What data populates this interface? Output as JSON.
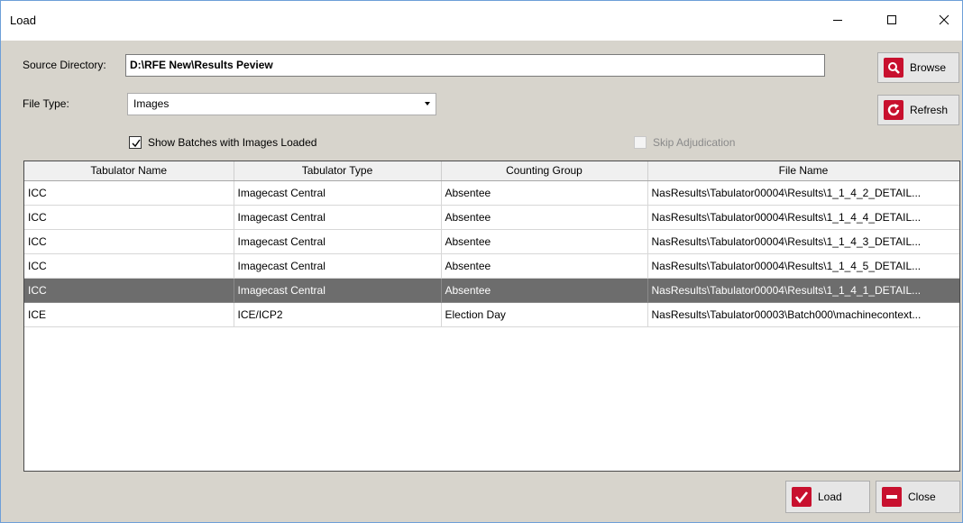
{
  "window": {
    "title": "Load"
  },
  "form": {
    "source_label": "Source Directory:",
    "source_value": "D:\\RFE New\\Results Peview",
    "filetype_label": "File Type:",
    "filetype_selected": "Images",
    "show_batches_label": "Show Batches with Images Loaded",
    "show_batches_checked": true,
    "skip_adjudication_label": "Skip Adjudication",
    "skip_adjudication_enabled": false
  },
  "buttons": {
    "browse": "Browse",
    "refresh": "Refresh",
    "load": "Load",
    "close": "Close"
  },
  "colors": {
    "browse_icon_bg": "#c8102e",
    "refresh_icon_bg": "#c8102e",
    "load_icon_bg": "#c8102e",
    "close_icon_bg": "#c8102e",
    "selected_row_bg": "#6d6d6d"
  },
  "table": {
    "columns": [
      "Tabulator Name",
      "Tabulator Type",
      "Counting Group",
      "File Name"
    ],
    "rows": [
      [
        "ICC",
        "Imagecast Central",
        "Absentee",
        "NasResults\\Tabulator00004\\Results\\1_1_4_2_DETAIL..."
      ],
      [
        "ICC",
        "Imagecast Central",
        "Absentee",
        "NasResults\\Tabulator00004\\Results\\1_1_4_4_DETAIL..."
      ],
      [
        "ICC",
        "Imagecast Central",
        "Absentee",
        "NasResults\\Tabulator00004\\Results\\1_1_4_3_DETAIL..."
      ],
      [
        "ICC",
        "Imagecast Central",
        "Absentee",
        "NasResults\\Tabulator00004\\Results\\1_1_4_5_DETAIL..."
      ],
      [
        "ICC",
        "Imagecast Central",
        "Absentee",
        "NasResults\\Tabulator00004\\Results\\1_1_4_1_DETAIL..."
      ],
      [
        "ICE",
        "ICE/ICP2",
        "Election Day",
        "NasResults\\Tabulator00003\\Batch000\\machinecontext..."
      ]
    ],
    "selected_row": 4
  }
}
